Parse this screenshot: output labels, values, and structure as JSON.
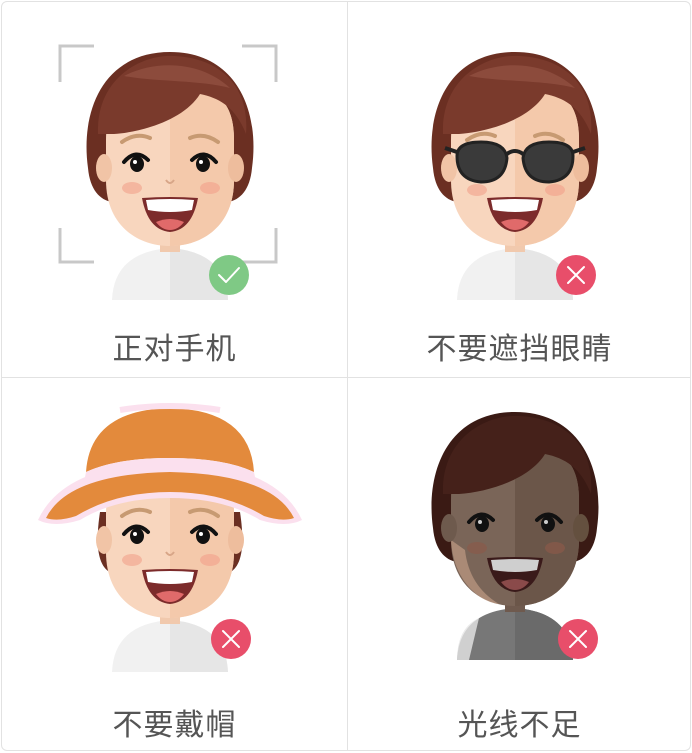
{
  "tips": [
    {
      "label": "正对手机",
      "status": "correct",
      "status_icon": "check-icon",
      "badge_color": "#7fc985",
      "variant": "normal"
    },
    {
      "label": "不要遮挡眼睛",
      "status": "wrong",
      "status_icon": "cross-icon",
      "badge_color": "#e84e6a",
      "variant": "sunglasses"
    },
    {
      "label": "不要戴帽",
      "status": "wrong",
      "status_icon": "cross-icon",
      "badge_color": "#e84e6a",
      "variant": "hat"
    },
    {
      "label": "光线不足",
      "status": "wrong",
      "status_icon": "cross-icon",
      "badge_color": "#e84e6a",
      "variant": "dark"
    }
  ],
  "colors": {
    "hair": "#6b2f22",
    "skin": "#f8d6be",
    "border": "#e2e2e2",
    "text": "#555555"
  }
}
